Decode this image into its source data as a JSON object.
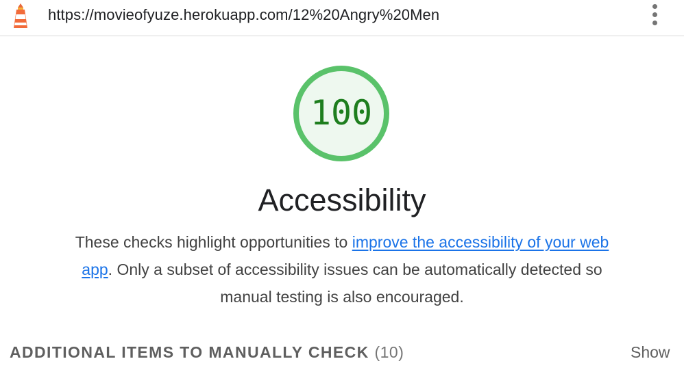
{
  "header": {
    "logo_icon": "lighthouse-icon",
    "url": "https://movieofyuze.herokuapp.com/12%20Angry%20Men",
    "menu_icon": "more-vertical-icon"
  },
  "gauge": {
    "score": "100",
    "fraction": 1.0,
    "ring_color": "#5ac26a",
    "fill_color": "#eef8ef",
    "text_color": "#1e7e1e"
  },
  "category": {
    "title": "Accessibility",
    "description_before": "These checks highlight opportunities to ",
    "description_link": "improve the accessibility of your web app",
    "description_after": ". Only a subset of accessibility issues can be automatically detected so manual testing is also encouraged.",
    "link_color": "#1a73e8"
  },
  "manual_section": {
    "title": "ADDITIONAL ITEMS TO MANUALLY CHECK",
    "count": "(10)",
    "toggle_label": "Show"
  }
}
